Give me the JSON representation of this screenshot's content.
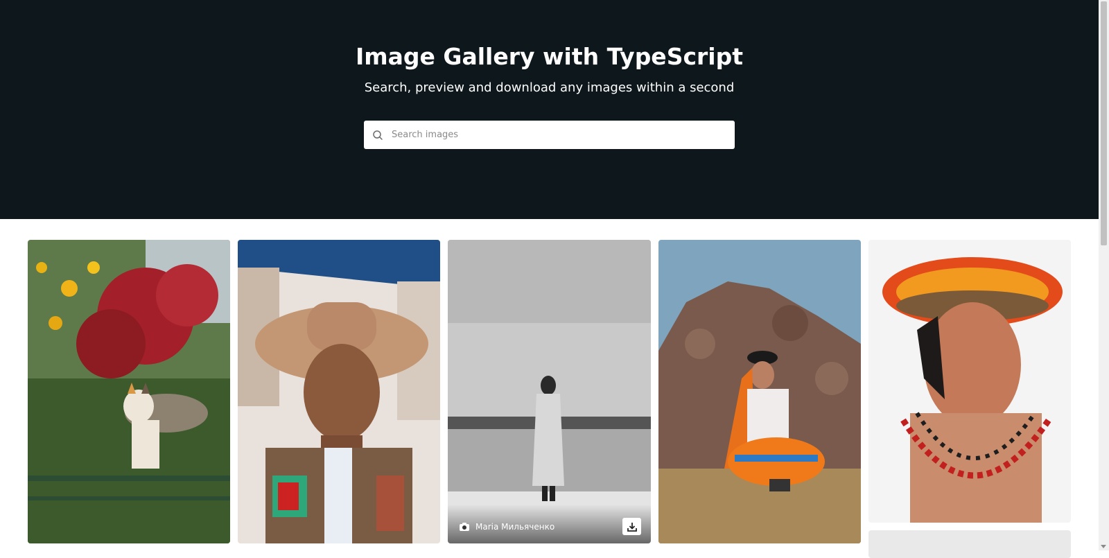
{
  "hero": {
    "title": "Image Gallery with TypeScript",
    "subtitle": "Search, preview and download any images within a second",
    "background": "#0d171c"
  },
  "search": {
    "placeholder": "Search images",
    "value": "",
    "icon": "search-icon"
  },
  "gallery": {
    "cards": [
      {
        "subject": "calico cat among flowers",
        "icon": "photo"
      },
      {
        "subject": "smiling man in wide-brim hat",
        "icon": "photo"
      },
      {
        "subject": "woman in white coat by lake, black and white",
        "icon": "photo",
        "photographer": "Maria Мильяченко",
        "photographer_icon": "camera-icon",
        "action_icon": "download-icon"
      },
      {
        "subject": "child in orange dress by rocks",
        "icon": "photo"
      },
      {
        "subject": "man with feather headdress",
        "icon": "photo"
      }
    ]
  },
  "colors": {
    "accent": "#0d171c",
    "page_bg": "#ffffff"
  }
}
